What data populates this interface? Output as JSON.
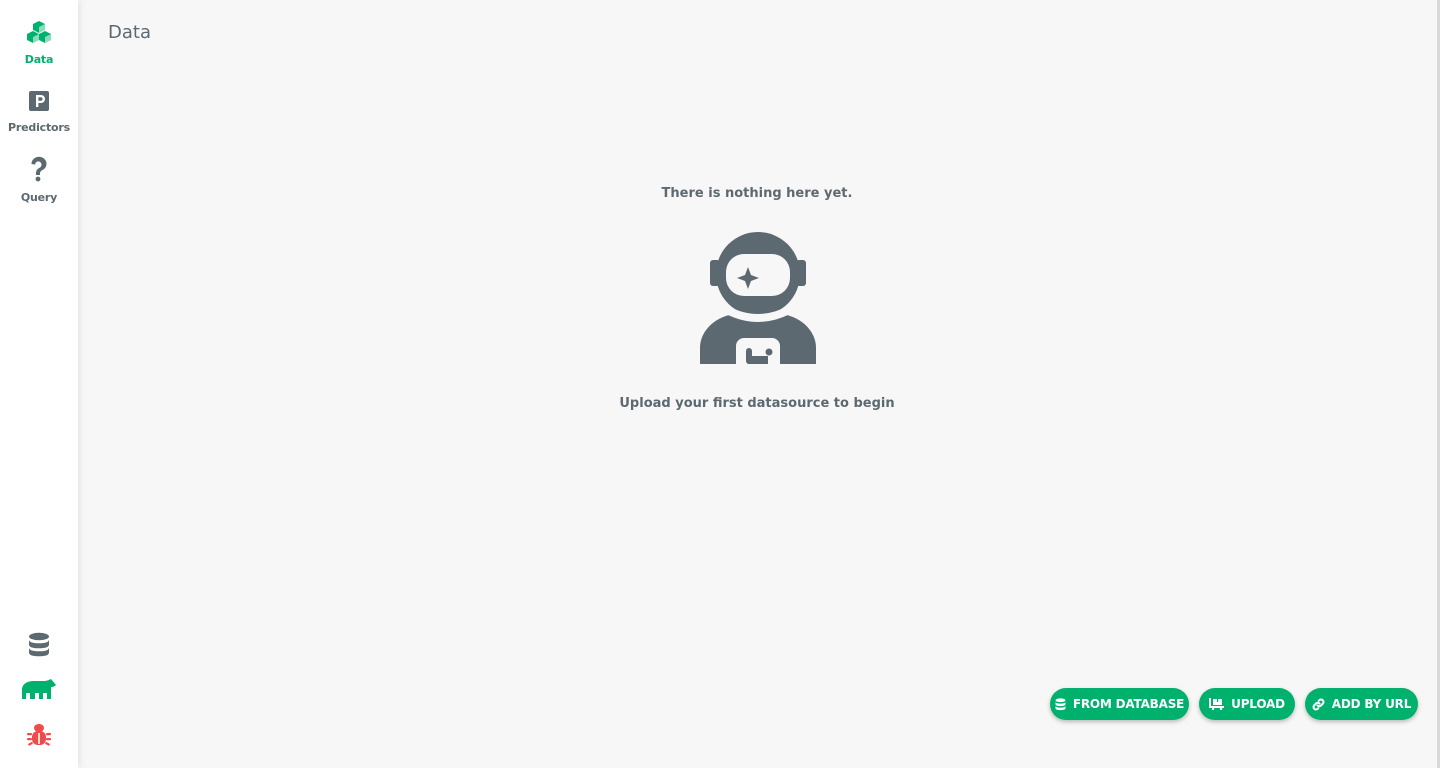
{
  "sidebar": {
    "items": [
      {
        "label": "Data",
        "icon": "cubes-icon",
        "active": true
      },
      {
        "label": "Predictors",
        "icon": "predictor-p-icon",
        "active": false
      },
      {
        "label": "Query",
        "icon": "question-icon",
        "active": false
      }
    ],
    "bottom_icons": [
      "database-icon",
      "mindsdb-logo-icon",
      "bug-icon"
    ]
  },
  "header": {
    "title": "Data"
  },
  "empty_state": {
    "title": "There is nothing here yet.",
    "icon": "astronaut-icon",
    "subtitle": "Upload your first datasource to begin"
  },
  "actions": {
    "from_database": "FROM DATABASE",
    "upload": "UPLOAD",
    "add_by_url": "ADD BY URL"
  },
  "colors": {
    "accent": "#00b06d",
    "text": "#5d6970",
    "background": "#f7f7f7",
    "bug": "#ef4b4b"
  }
}
